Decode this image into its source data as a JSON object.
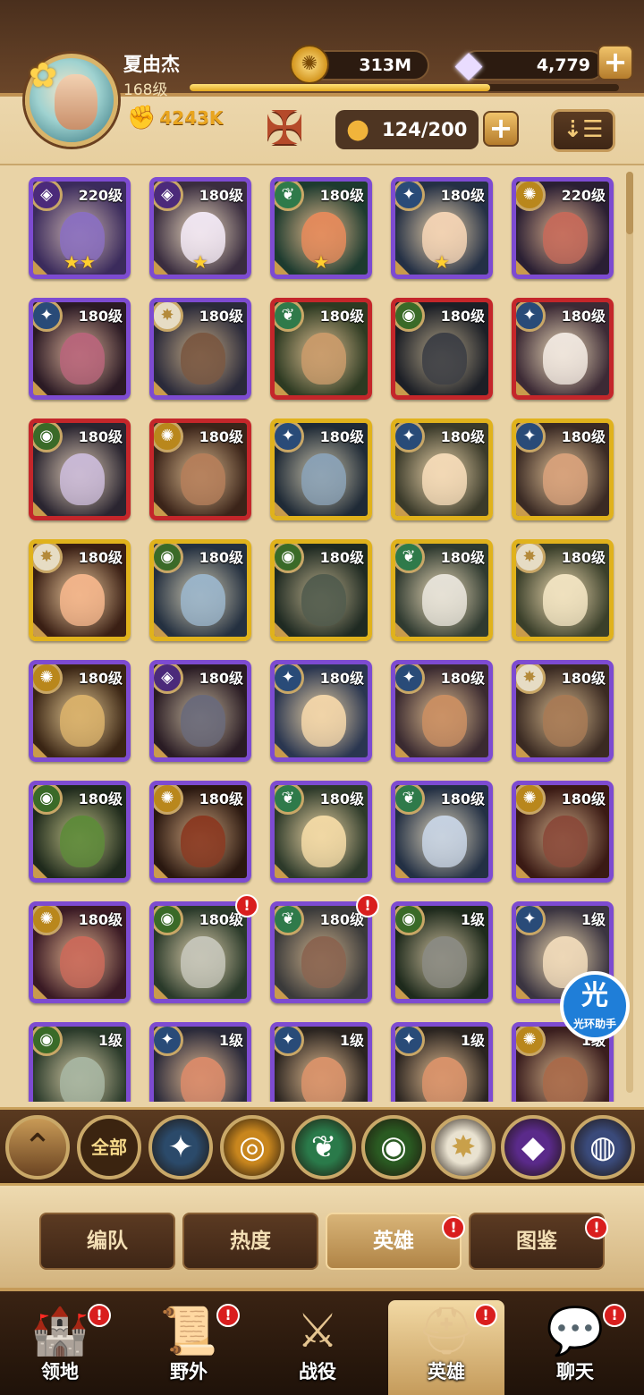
{
  "player": {
    "name": "夏由杰",
    "level": "168级",
    "power": "4243K",
    "xp_progress": 0.7
  },
  "currency": {
    "gold": "313M",
    "gems": "4,779"
  },
  "roster": {
    "count": "124/200"
  },
  "heroes": [
    {
      "level": "220级",
      "faction": "mauler",
      "frame": "purple",
      "stars": "★★",
      "bg": "#3b2b5c",
      "skin": "#8a6fbf"
    },
    {
      "level": "180级",
      "faction": "mauler",
      "frame": "purple",
      "stars": "★",
      "bg": "#3a2d3f",
      "skin": "#f0e6f2"
    },
    {
      "level": "180级",
      "faction": "wilder",
      "frame": "purple",
      "stars": "★",
      "bg": "#1d3b2f",
      "skin": "#e38a5b"
    },
    {
      "level": "180级",
      "faction": "lightbearer",
      "frame": "purple",
      "stars": "★",
      "bg": "#243045",
      "skin": "#f2d2b3"
    },
    {
      "level": "220级",
      "faction": "graveborn",
      "frame": "purple",
      "stars": "",
      "bg": "#2a1f33",
      "skin": "#c46a5a"
    },
    {
      "level": "180级",
      "faction": "lightbearer",
      "frame": "purple",
      "stars": "",
      "bg": "#2b1a24",
      "skin": "#b7657a"
    },
    {
      "level": "180级",
      "faction": "celestial",
      "frame": "purple",
      "stars": "",
      "bg": "#2a2a3a",
      "skin": "#7a5842"
    },
    {
      "level": "180级",
      "faction": "wilder",
      "frame": "red",
      "stars": "",
      "bg": "#2d3a22",
      "skin": "#c89a6a"
    },
    {
      "level": "180级",
      "faction": "dimensional",
      "frame": "red",
      "stars": "",
      "bg": "#1c1f26",
      "skin": "#3d3f45"
    },
    {
      "level": "180级",
      "faction": "lightbearer",
      "frame": "red",
      "stars": "",
      "bg": "#3c2a35",
      "skin": "#efe6de"
    },
    {
      "level": "180级",
      "faction": "dimensional",
      "frame": "red",
      "stars": "",
      "bg": "#2a2530",
      "skin": "#c9b9d6"
    },
    {
      "level": "180级",
      "faction": "graveborn",
      "frame": "red",
      "stars": "",
      "bg": "#3b2419",
      "skin": "#b47e5a"
    },
    {
      "level": "180级",
      "faction": "lightbearer",
      "frame": "gold",
      "stars": "",
      "bg": "#1f2a36",
      "skin": "#8aa1b5"
    },
    {
      "level": "180级",
      "faction": "lightbearer",
      "frame": "gold",
      "stars": "",
      "bg": "#3a3a2a",
      "skin": "#f3d9b6"
    },
    {
      "level": "180级",
      "faction": "lightbearer",
      "frame": "gold",
      "stars": "",
      "bg": "#3a2a24",
      "skin": "#d6a07a"
    },
    {
      "level": "180级",
      "faction": "celestial",
      "frame": "gold",
      "stars": "",
      "bg": "#3a1f14",
      "skin": "#f2b48a"
    },
    {
      "level": "180级",
      "faction": "dimensional",
      "frame": "gold",
      "stars": "",
      "bg": "#243040",
      "skin": "#9ab4c9"
    },
    {
      "level": "180级",
      "faction": "dimensional",
      "frame": "gold",
      "stars": "",
      "bg": "#1f2a22",
      "skin": "#525c4e"
    },
    {
      "level": "180级",
      "faction": "wilder",
      "frame": "gold",
      "stars": "",
      "bg": "#2f3a30",
      "skin": "#e6e2d8"
    },
    {
      "level": "180级",
      "faction": "celestial",
      "frame": "gold",
      "stars": "",
      "bg": "#3a3f2a",
      "skin": "#f0e2c0"
    },
    {
      "level": "180级",
      "faction": "graveborn",
      "frame": "purple",
      "stars": "",
      "bg": "#3a2514",
      "skin": "#d8b06a"
    },
    {
      "level": "180级",
      "faction": "mauler",
      "frame": "purple",
      "stars": "",
      "bg": "#2a1c24",
      "skin": "#6a6a7a"
    },
    {
      "level": "180级",
      "faction": "lightbearer",
      "frame": "purple",
      "stars": "",
      "bg": "#2a3650",
      "skin": "#f1d4a8"
    },
    {
      "level": "180级",
      "faction": "lightbearer",
      "frame": "purple",
      "stars": "",
      "bg": "#3a2a30",
      "skin": "#c98e62"
    },
    {
      "level": "180级",
      "faction": "celestial",
      "frame": "purple",
      "stars": "",
      "bg": "#3a2a22",
      "skin": "#a77a55"
    },
    {
      "level": "180级",
      "faction": "dimensional",
      "frame": "purple",
      "stars": "",
      "bg": "#1f2a1c",
      "skin": "#5e8a3a"
    },
    {
      "level": "180级",
      "faction": "graveborn",
      "frame": "purple",
      "stars": "",
      "bg": "#2a1810",
      "skin": "#8a3a22"
    },
    {
      "level": "180级",
      "faction": "wilder",
      "frame": "purple",
      "stars": "",
      "bg": "#2d3a2a",
      "skin": "#f1d8a4"
    },
    {
      "level": "180级",
      "faction": "wilder",
      "frame": "purple",
      "stars": "",
      "bg": "#233044",
      "skin": "#c6d2e2"
    },
    {
      "level": "180级",
      "faction": "graveborn",
      "frame": "purple",
      "stars": "",
      "bg": "#3a1a14",
      "skin": "#8a4a3a"
    },
    {
      "level": "180级",
      "faction": "graveborn",
      "frame": "purple",
      "stars": "",
      "bg": "#3a1a24",
      "skin": "#c96a5a",
      "alert": false
    },
    {
      "level": "180级",
      "faction": "dimensional",
      "frame": "purple",
      "stars": "",
      "bg": "#2a3a2a",
      "skin": "#c4c4b8",
      "alert": true
    },
    {
      "level": "180级",
      "faction": "wilder",
      "frame": "purple",
      "stars": "",
      "bg": "#3a3a3a",
      "skin": "#8a6450",
      "alert": true
    },
    {
      "level": "1级",
      "faction": "dimensional",
      "frame": "purple",
      "stars": "",
      "bg": "#1e2a1c",
      "skin": "#8a8a82"
    },
    {
      "level": "1级",
      "faction": "lightbearer",
      "frame": "purple",
      "stars": "",
      "bg": "#3a3440",
      "skin": "#eed8b8"
    },
    {
      "level": "1级",
      "faction": "dimensional",
      "frame": "purple",
      "stars": "",
      "bg": "#2a3a2a",
      "skin": "#a6b4a0"
    },
    {
      "level": "1级",
      "faction": "lightbearer",
      "frame": "purple",
      "stars": "",
      "bg": "#2a2a3a",
      "skin": "#d88a6a"
    },
    {
      "level": "1级",
      "faction": "lightbearer",
      "frame": "purple",
      "stars": "",
      "bg": "#2a2420",
      "skin": "#d8926a"
    },
    {
      "level": "1级",
      "faction": "lightbearer",
      "frame": "purple",
      "stars": "",
      "bg": "#2a2420",
      "skin": "#d8926a"
    },
    {
      "level": "1级",
      "faction": "graveborn",
      "frame": "purple",
      "stars": "",
      "bg": "#3a1e1e",
      "skin": "#a86a4a"
    }
  ],
  "assistant": {
    "glyph": "光",
    "label": "光环助手"
  },
  "filters": [
    {
      "name": "up",
      "glyph": "⌃"
    },
    {
      "name": "all",
      "label": "全部"
    },
    {
      "name": "lightbearer",
      "glyph": "✦",
      "color": "#2b4a6a"
    },
    {
      "name": "mauler",
      "glyph": "◎",
      "color": "#c8861e"
    },
    {
      "name": "wilder",
      "glyph": "❦",
      "color": "#2a7a4a"
    },
    {
      "name": "graveborn",
      "glyph": "◉",
      "color": "#2a5a22"
    },
    {
      "name": "celestial",
      "glyph": "✸",
      "color": "#e9e2d0"
    },
    {
      "name": "hypogean",
      "glyph": "◆",
      "color": "#5a2a8a"
    },
    {
      "name": "dimensional",
      "glyph": "◍",
      "color": "#3a4a7a"
    }
  ],
  "subtabs": [
    {
      "label": "编队",
      "active": false,
      "alert": false
    },
    {
      "label": "热度",
      "active": false,
      "alert": false
    },
    {
      "label": "英雄",
      "active": true,
      "alert": true
    },
    {
      "label": "图鉴",
      "active": false,
      "alert": true
    }
  ],
  "nav": [
    {
      "label": "领地",
      "icon": "castle-icon",
      "glyph": "🏰",
      "active": false,
      "alert": true
    },
    {
      "label": "野外",
      "icon": "map-scroll-icon",
      "glyph": "📜",
      "active": false,
      "alert": true
    },
    {
      "label": "战役",
      "icon": "sword-shield-icon",
      "glyph": "⚔",
      "active": false,
      "alert": false
    },
    {
      "label": "英雄",
      "icon": "hero-helmet-icon",
      "glyph": "⛑",
      "active": true,
      "alert": true
    },
    {
      "label": "聊天",
      "icon": "chat-bubble-icon",
      "glyph": "💬",
      "active": false,
      "alert": true
    }
  ],
  "colors": {
    "frame_purple": "#7d4bd1",
    "frame_red": "#c4262a",
    "frame_gold": "#e0b21c",
    "faction_lightbearer": "#294b78",
    "faction_mauler": "#4b2a7a",
    "faction_wilder": "#2f7a4a",
    "faction_graveborn": "#b9871c",
    "faction_celestial": "#e6dcc4",
    "faction_dimensional": "#3a6a28",
    "alert": "#d91e1e"
  }
}
